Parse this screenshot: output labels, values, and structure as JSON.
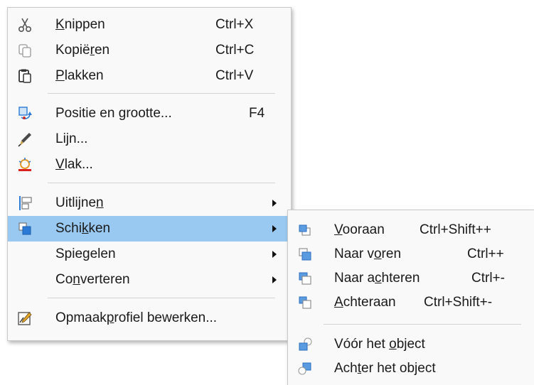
{
  "main_menu": {
    "items": [
      {
        "id": "cut",
        "label_pre": "",
        "label_ul": "K",
        "label_post": "nippen",
        "shortcut": "Ctrl+X",
        "icon": "scissors-icon"
      },
      {
        "id": "copy",
        "label_pre": "Kopië",
        "label_ul": "r",
        "label_post": "en",
        "shortcut": "Ctrl+C",
        "icon": "copy-icon"
      },
      {
        "id": "paste",
        "label_pre": "",
        "label_ul": "P",
        "label_post": "lakken",
        "shortcut": "Ctrl+V",
        "icon": "paste-icon"
      },
      {
        "id": "position-size",
        "label_pre": "Positie en ",
        "label_ul": "g",
        "label_post": "rootte...",
        "shortcut": "F4",
        "icon": "position-size-icon"
      },
      {
        "id": "line",
        "label_pre": "Li",
        "label_ul": "j",
        "label_post": "n...",
        "shortcut": "",
        "icon": "pen-icon"
      },
      {
        "id": "area",
        "label_pre": "",
        "label_ul": "V",
        "label_post": "lak...",
        "shortcut": "",
        "icon": "area-fill-icon"
      },
      {
        "id": "align",
        "label_pre": "Uitlijne",
        "label_ul": "n",
        "label_post": "",
        "shortcut": "",
        "icon": "align-icon"
      },
      {
        "id": "arrange",
        "label_pre": "Schi",
        "label_ul": "k",
        "label_post": "ken",
        "shortcut": "",
        "icon": "arrange-icon"
      },
      {
        "id": "flip",
        "label_pre": "Spie",
        "label_ul": "g",
        "label_post": "elen",
        "shortcut": "",
        "icon": ""
      },
      {
        "id": "convert",
        "label_pre": "Co",
        "label_ul": "n",
        "label_post": "verteren",
        "shortcut": "",
        "icon": ""
      },
      {
        "id": "edit-style",
        "label_pre": "Opmaak",
        "label_ul": "p",
        "label_post": "rofiel bewerken...",
        "shortcut": "",
        "icon": "edit-style-icon"
      }
    ]
  },
  "sub_menu": {
    "items": [
      {
        "id": "bring-to-front",
        "label_pre": "",
        "label_ul": "V",
        "label_post": "ooraan",
        "shortcut": "Ctrl+Shift++",
        "icon": "bring-to-front-icon"
      },
      {
        "id": "bring-forward",
        "label_pre": "Naar v",
        "label_ul": "o",
        "label_post": "ren",
        "shortcut": "Ctrl++",
        "icon": "bring-forward-icon"
      },
      {
        "id": "send-backward",
        "label_pre": "Naar a",
        "label_ul": "c",
        "label_post": "hteren",
        "shortcut": "Ctrl+-",
        "icon": "send-backward-icon"
      },
      {
        "id": "send-to-back",
        "label_pre": "",
        "label_ul": "A",
        "label_post": "chteraan",
        "shortcut": "Ctrl+Shift+-",
        "icon": "send-to-back-icon"
      },
      {
        "id": "in-front-of-object",
        "label_pre": "Vóór het ",
        "label_ul": "o",
        "label_post": "bject",
        "shortcut": "",
        "icon": "in-front-of-object-icon"
      },
      {
        "id": "behind-object",
        "label_pre": "Ach",
        "label_ul": "t",
        "label_post": "er het object",
        "shortcut": "",
        "icon": "behind-object-icon"
      }
    ]
  },
  "colors": {
    "highlight": "#99c9f0",
    "menu_bg": "#f9f9f9",
    "accent_blue": "#2b7bd6"
  }
}
